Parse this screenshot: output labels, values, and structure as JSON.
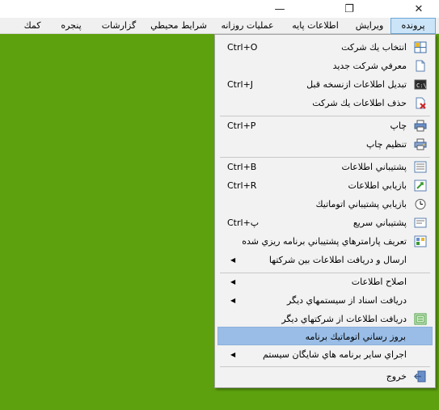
{
  "window": {
    "close_glyph": "✕",
    "restore_glyph": "❐",
    "minimize_glyph": "—"
  },
  "menubar": {
    "items": [
      "پرونده",
      "ويرايش",
      "اطلاعات پايه",
      "عمليات روزانه",
      "شرايط محيطي",
      "گزارشات",
      "پنجره",
      "کمك"
    ],
    "active": "پرونده"
  },
  "file_menu": {
    "items": [
      {
        "label": "انتخاب يك شركت",
        "shortcut": "Ctrl+O",
        "icon": "grid-icon"
      },
      {
        "label": "معرفي شركت جديد",
        "shortcut": "",
        "icon": "new-document-icon"
      },
      {
        "label": "تبديل اطلاعات ازنسخه قبل",
        "shortcut": "Ctrl+J",
        "icon": "console-icon"
      },
      {
        "label": "حذف اطلاعات يك شركت",
        "shortcut": "",
        "icon": "delete-document-icon"
      },
      {
        "label": "چاپ",
        "shortcut": "Ctrl+P",
        "icon": "printer-icon"
      },
      {
        "label": "تنظيم چاپ",
        "shortcut": "",
        "icon": "print-setup-icon"
      },
      {
        "label": "پشتيباني اطلاعات",
        "shortcut": "Ctrl+B",
        "icon": "backup-icon"
      },
      {
        "label": "بازيابي اطلاعات",
        "shortcut": "Ctrl+R",
        "icon": "restore-icon"
      },
      {
        "label": "بازيابي پشتيباني اتوماتيك",
        "shortcut": "",
        "icon": "clock-icon"
      },
      {
        "label": "پشتيباني سريع",
        "shortcut": "Ctrl+پ",
        "icon": "quick-backup-icon"
      },
      {
        "label": "تعريف پارامترهاي پشتيباني برنامه ريزي شده",
        "shortcut": "",
        "icon": "schedule-icon"
      },
      {
        "label": "ارسال و دريافت اطلاعات بين شركتها",
        "shortcut": "",
        "submenu": true
      },
      {
        "label": "اصلاح اطلاعات",
        "shortcut": "",
        "submenu": true
      },
      {
        "label": "دريافت اسناد از سيستمهاي ديگر",
        "shortcut": "",
        "submenu": true
      },
      {
        "label": "دريافت اطلاعات از شركتهاي ديگر",
        "shortcut": "",
        "icon": "import-icon"
      },
      {
        "label": "بروز رساني اتوماتيك برنامه",
        "shortcut": "",
        "highlight": true
      },
      {
        "label": "اجراي ساير برنامه هاي شايگان سيستم",
        "shortcut": "",
        "submenu": true
      },
      {
        "label": "خروج",
        "shortcut": "",
        "icon": "exit-icon"
      }
    ]
  },
  "colors": {
    "desktop": "#5da20e",
    "highlight": "#99bde6",
    "menubar_active": "#cce4f7"
  }
}
